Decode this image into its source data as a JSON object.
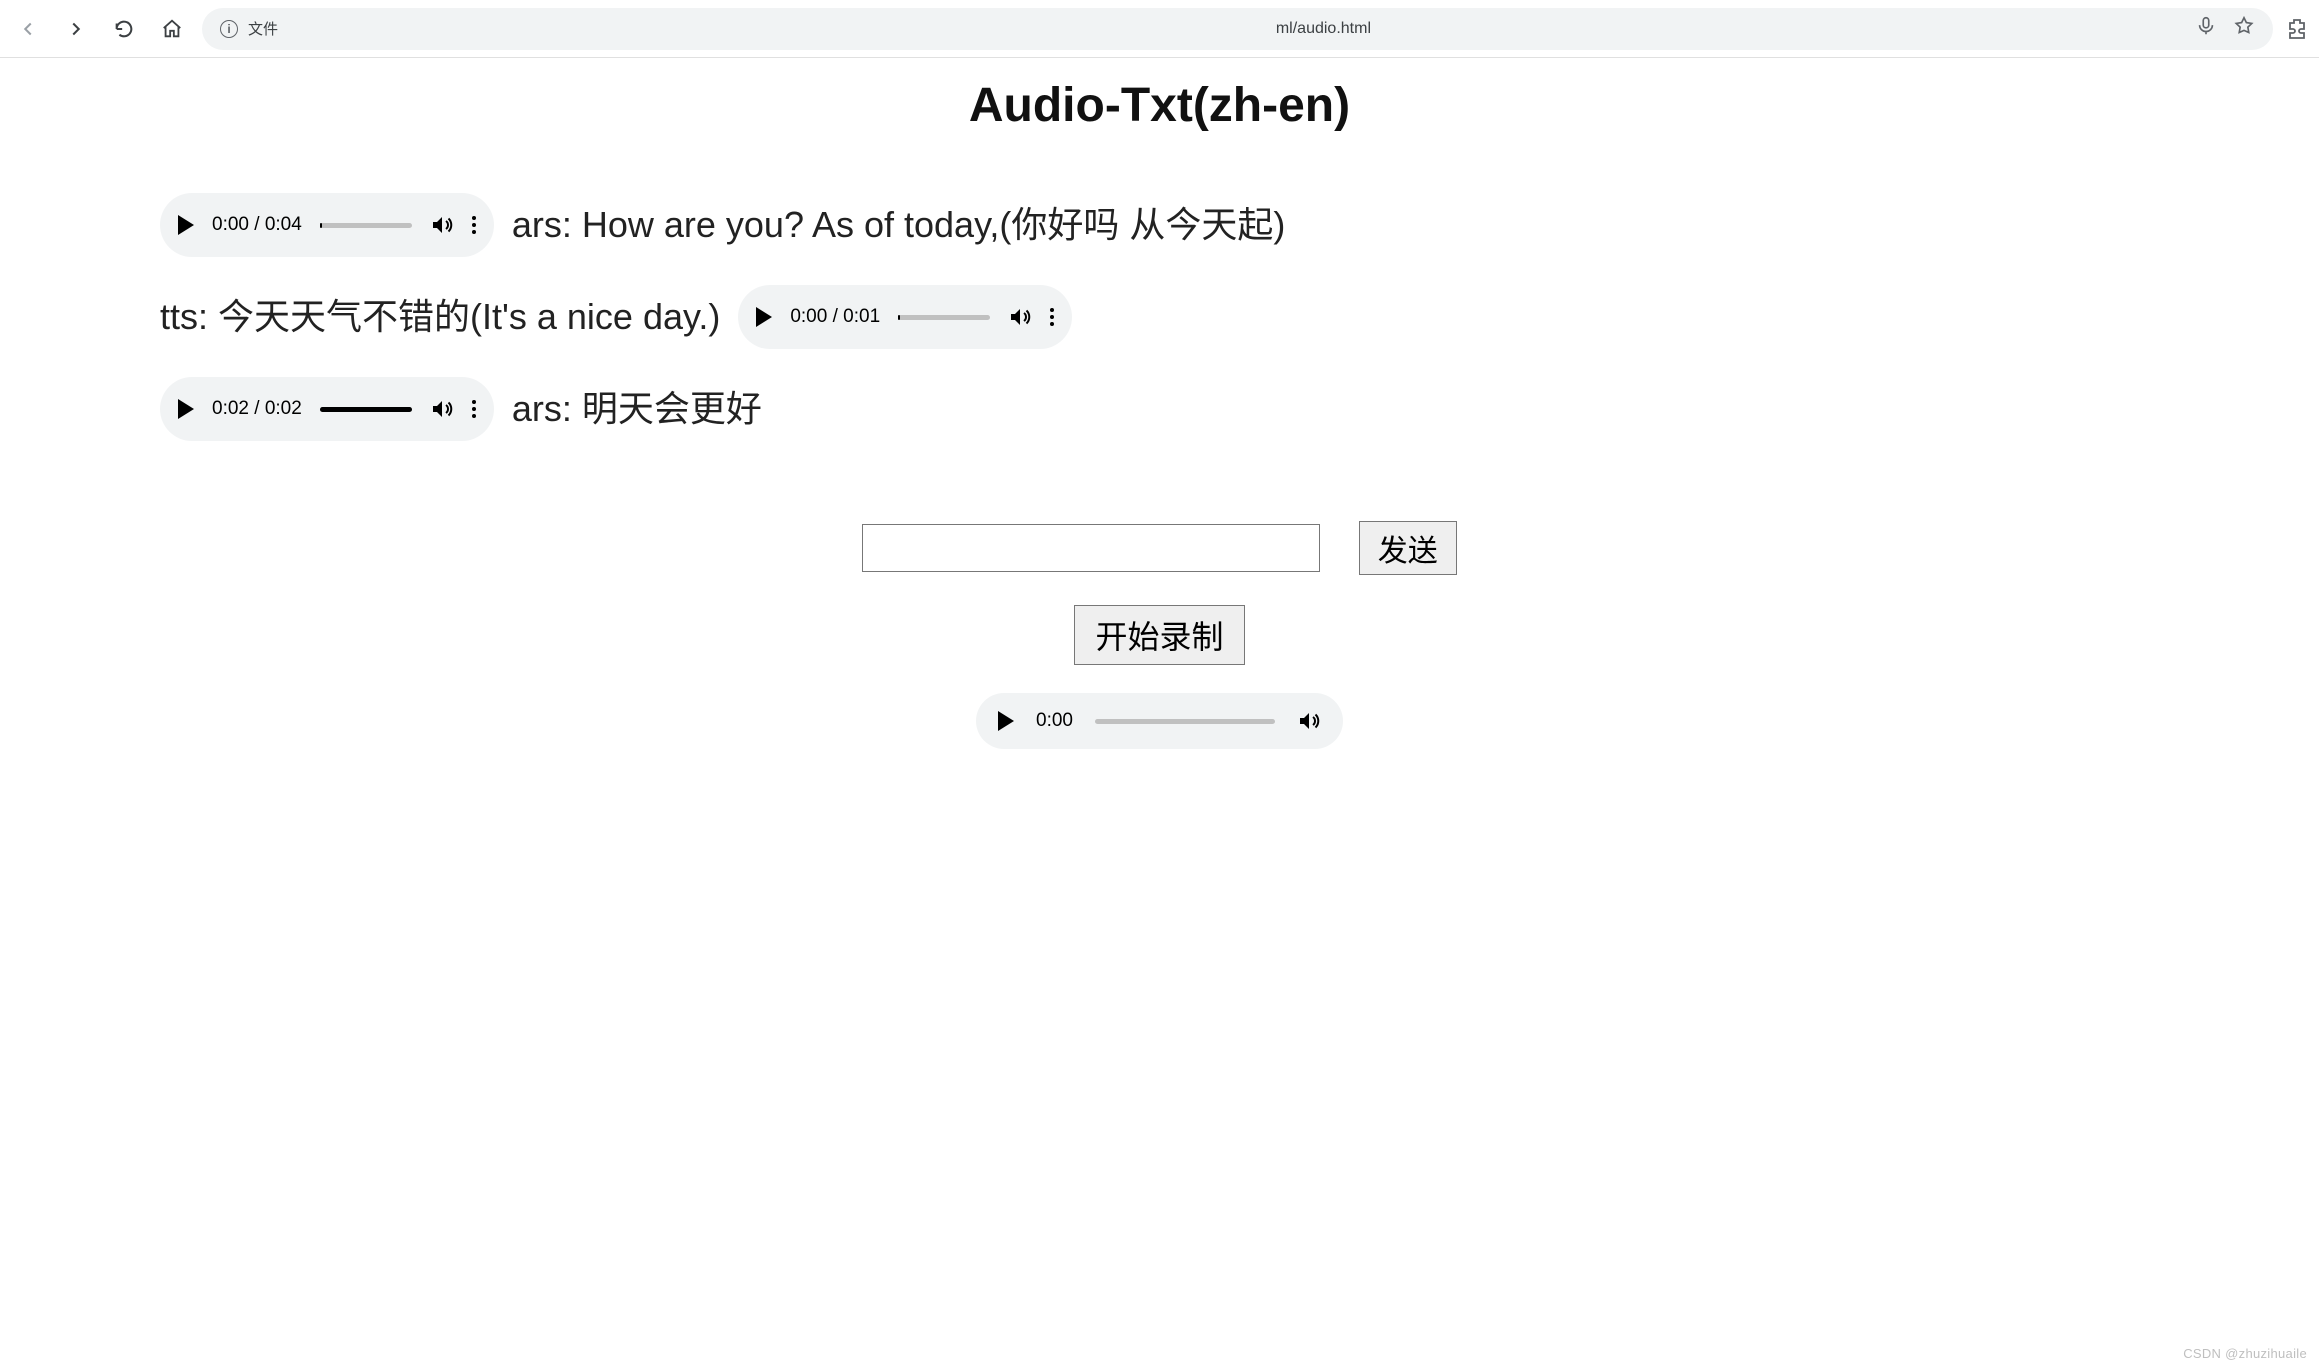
{
  "browser": {
    "file_label": "文件",
    "url_fragment": "ml/audio.html"
  },
  "page": {
    "title": "Audio-Txt(zh-en)"
  },
  "messages": [
    {
      "audio": {
        "current": "0:00",
        "duration": "0:04",
        "progress_pct": 2
      },
      "text": "ars: How are you? As of today,(你好吗 从今天起)"
    },
    {
      "text_before": "tts: 今天天气不错的(It's a nice day.)",
      "audio_after": {
        "current": "0:00",
        "duration": "0:01",
        "progress_pct": 2
      }
    },
    {
      "audio": {
        "current": "0:02",
        "duration": "0:02",
        "progress_pct": 100
      },
      "text": "ars: 明天会更好"
    }
  ],
  "form": {
    "send_label": "发送",
    "record_label": "开始录制"
  },
  "bottom_audio": {
    "current": "0:00"
  },
  "watermark": "CSDN @zhuzihuaile"
}
